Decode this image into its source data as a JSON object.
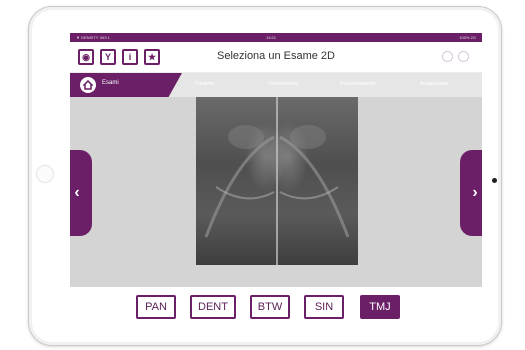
{
  "status_bar": {
    "left": "▼ DENSITY X63 1",
    "center": "13:21",
    "right": "100% 2G"
  },
  "toolbar": {
    "buttons": [
      {
        "icon": "eye-icon",
        "glyph": "◉"
      },
      {
        "icon": "filter-icon",
        "glyph": "Y"
      },
      {
        "icon": "info-icon",
        "glyph": "i"
      },
      {
        "icon": "star-icon",
        "glyph": "★"
      }
    ],
    "title": "Seleziona un Esame 2D"
  },
  "nav": {
    "home_label": "Esami",
    "tabs": [
      "Paziente",
      "Orientamento",
      "Posizionamento",
      "Acquisizione"
    ]
  },
  "viewer": {
    "left_arrow": "‹",
    "right_arrow": "›"
  },
  "exam_types": [
    {
      "label": "PAN",
      "selected": false
    },
    {
      "label": "DENT",
      "selected": false
    },
    {
      "label": "BTW",
      "selected": false
    },
    {
      "label": "SIN",
      "selected": false
    },
    {
      "label": "TMJ",
      "selected": true
    }
  ],
  "colors": {
    "accent": "#6a1f66",
    "nav_strip": "#e6e6e6",
    "viewer_bg": "#d4d4d4"
  }
}
